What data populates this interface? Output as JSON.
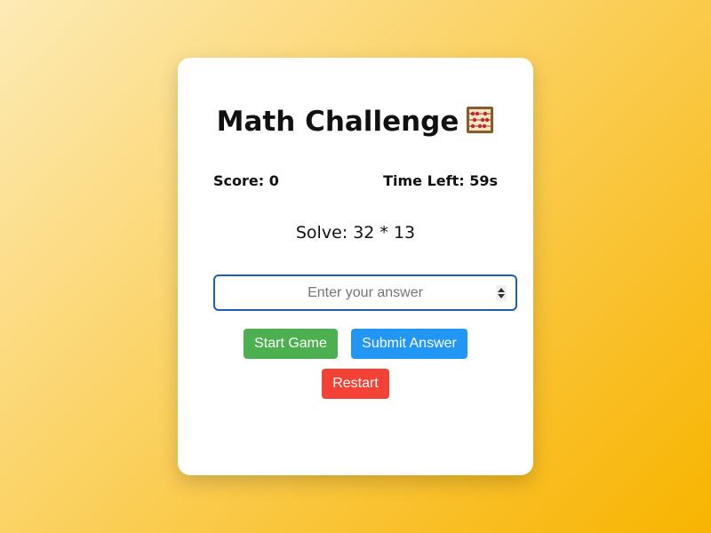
{
  "game": {
    "title": "Math Challenge",
    "title_icon": "abacus-icon",
    "score_text": "Score: 0",
    "time_text": "Time Left: 59s",
    "problem_text": "Solve: 32 * 13",
    "answer_input": {
      "value": "",
      "placeholder": "Enter your answer"
    },
    "buttons": {
      "start_label": "Start Game",
      "submit_label": "Submit Answer",
      "restart_label": "Restart"
    }
  },
  "colors": {
    "start": "#4caf50",
    "submit": "#2196f3",
    "restart": "#f44336",
    "input_border": "#1a5fb4"
  }
}
